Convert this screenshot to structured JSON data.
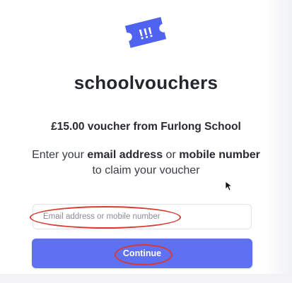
{
  "brand": {
    "name": "schoolvouchers",
    "logo_icon": "ticket-icon",
    "logo_glyph": "!!!",
    "logo_color": "#4f63f0"
  },
  "voucher": {
    "title": "£15.00 voucher from Furlong School"
  },
  "instructions": {
    "part1": "Enter your ",
    "bold1": "email address",
    "part2": " or ",
    "bold2": "mobile number",
    "part3": " to claim your voucher"
  },
  "form": {
    "input_placeholder": "Email address or mobile number",
    "continue_label": "Continue",
    "button_color": "#5e71f3",
    "annotation_color": "#d93a31"
  }
}
